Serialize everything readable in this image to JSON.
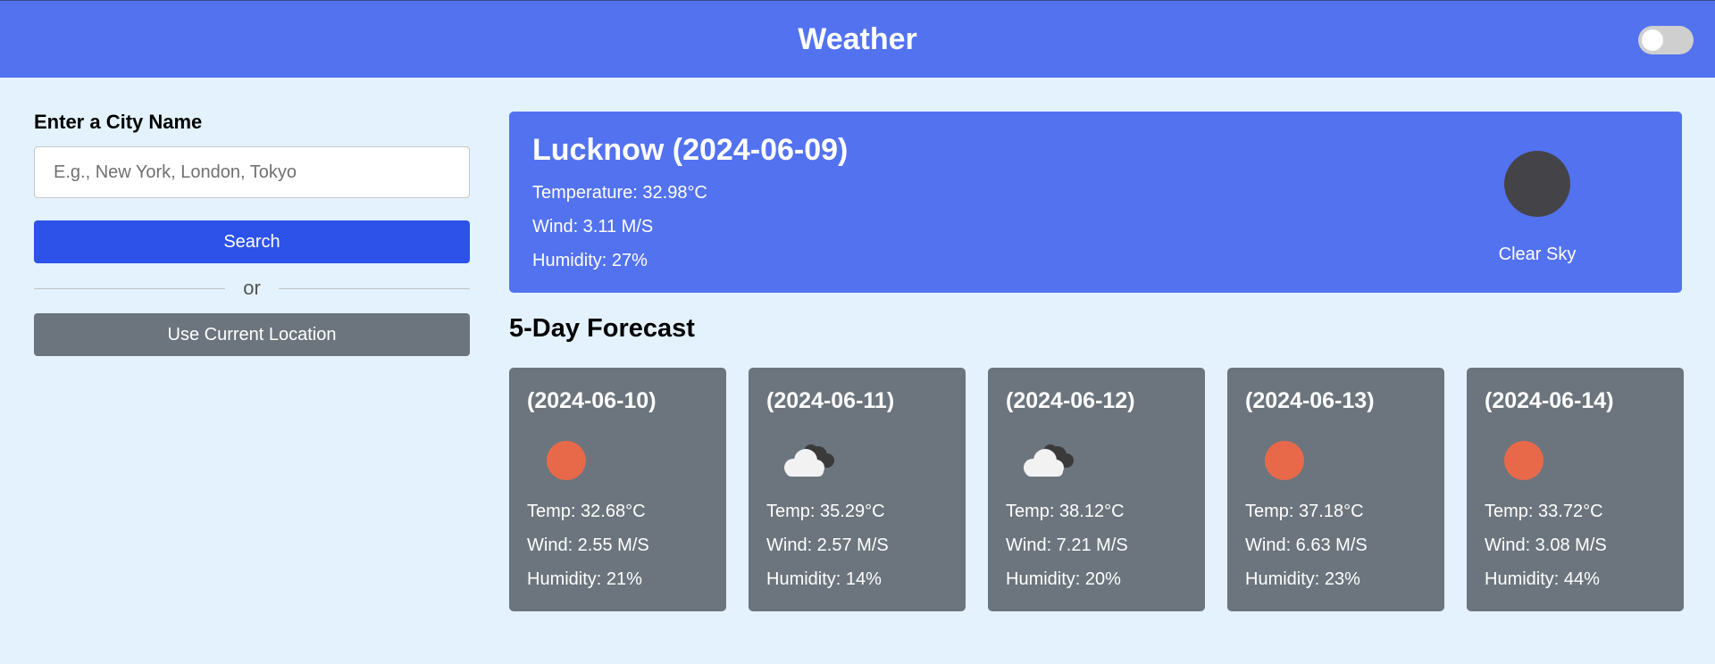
{
  "header": {
    "title": "Weather"
  },
  "sidebar": {
    "label": "Enter a City Name",
    "input_placeholder": "E.g., New York, London, Tokyo",
    "search_label": "Search",
    "divider_text": "or",
    "location_label": "Use Current Location"
  },
  "current": {
    "title": "Lucknow (2024-06-09)",
    "temperature": "Temperature: 32.98°C",
    "wind": "Wind: 3.11 M/S",
    "humidity": "Humidity: 27%",
    "description": "Clear Sky",
    "icon": "clear-sky-icon"
  },
  "forecast": {
    "title": "5-Day Forecast",
    "days": [
      {
        "date": "(2024-06-10)",
        "icon": "sun-icon",
        "temp": "Temp: 32.68°C",
        "wind": "Wind: 2.55 M/S",
        "humidity": "Humidity: 21%"
      },
      {
        "date": "(2024-06-11)",
        "icon": "cloud-icon",
        "temp": "Temp: 35.29°C",
        "wind": "Wind: 2.57 M/S",
        "humidity": "Humidity: 14%"
      },
      {
        "date": "(2024-06-12)",
        "icon": "cloud-icon",
        "temp": "Temp: 38.12°C",
        "wind": "Wind: 7.21 M/S",
        "humidity": "Humidity: 20%"
      },
      {
        "date": "(2024-06-13)",
        "icon": "sun-icon",
        "temp": "Temp: 37.18°C",
        "wind": "Wind: 6.63 M/S",
        "humidity": "Humidity: 23%"
      },
      {
        "date": "(2024-06-14)",
        "icon": "sun-icon",
        "temp": "Temp: 33.72°C",
        "wind": "Wind: 3.08 M/S",
        "humidity": "Humidity: 44%"
      }
    ]
  },
  "colors": {
    "primary": "#5372f0",
    "search_button": "#2d52ea",
    "secondary": "#6c757d",
    "background": "#e3f2fd",
    "sun": "#e8694a"
  }
}
